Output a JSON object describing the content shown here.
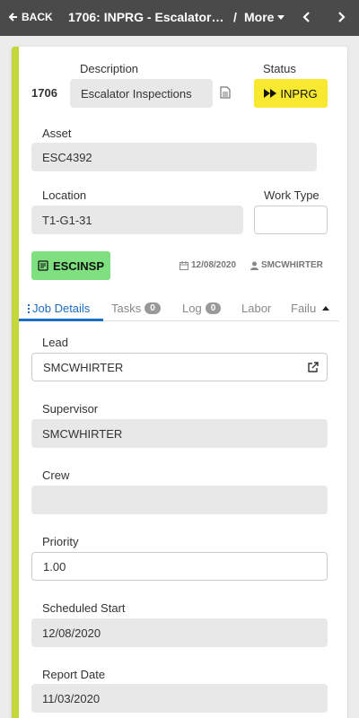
{
  "topbar": {
    "back_label": "BACK",
    "title": "1706: INPRG - Escalator Inspections",
    "separator": "/",
    "more_label": "More"
  },
  "workorder": {
    "number": "1706",
    "description_label": "Description",
    "description": "Escalator Inspections",
    "status_label": "Status",
    "status": "INPRG",
    "asset_label": "Asset",
    "asset": "ESC4392",
    "location_label": "Location",
    "location": "T1-G1-31",
    "worktype_label": "Work Type",
    "worktype": "",
    "jobplan": "ESCINSP",
    "date": "12/08/2020",
    "owner": "SMCWHIRTER"
  },
  "tabs": [
    {
      "label": "Job Details"
    },
    {
      "label": "Tasks",
      "count": "0"
    },
    {
      "label": "Log",
      "count": "0"
    },
    {
      "label": "Labor"
    },
    {
      "label": "Failu"
    }
  ],
  "details": {
    "lead_label": "Lead",
    "lead": "SMCWHIRTER",
    "supervisor_label": "Supervisor",
    "supervisor": "SMCWHIRTER",
    "crew_label": "Crew",
    "crew": "",
    "priority_label": "Priority",
    "priority": "1.00",
    "sched_start_label": "Scheduled Start",
    "sched_start": "12/08/2020",
    "report_date_label": "Report Date",
    "report_date": "11/03/2020"
  },
  "colors": {
    "topbar": "#4a4a4a",
    "accent": "#c5d83b",
    "status": "#f6e930",
    "jobplan_badge": "#7ee07e",
    "active_tab": "#1b6ec2"
  }
}
